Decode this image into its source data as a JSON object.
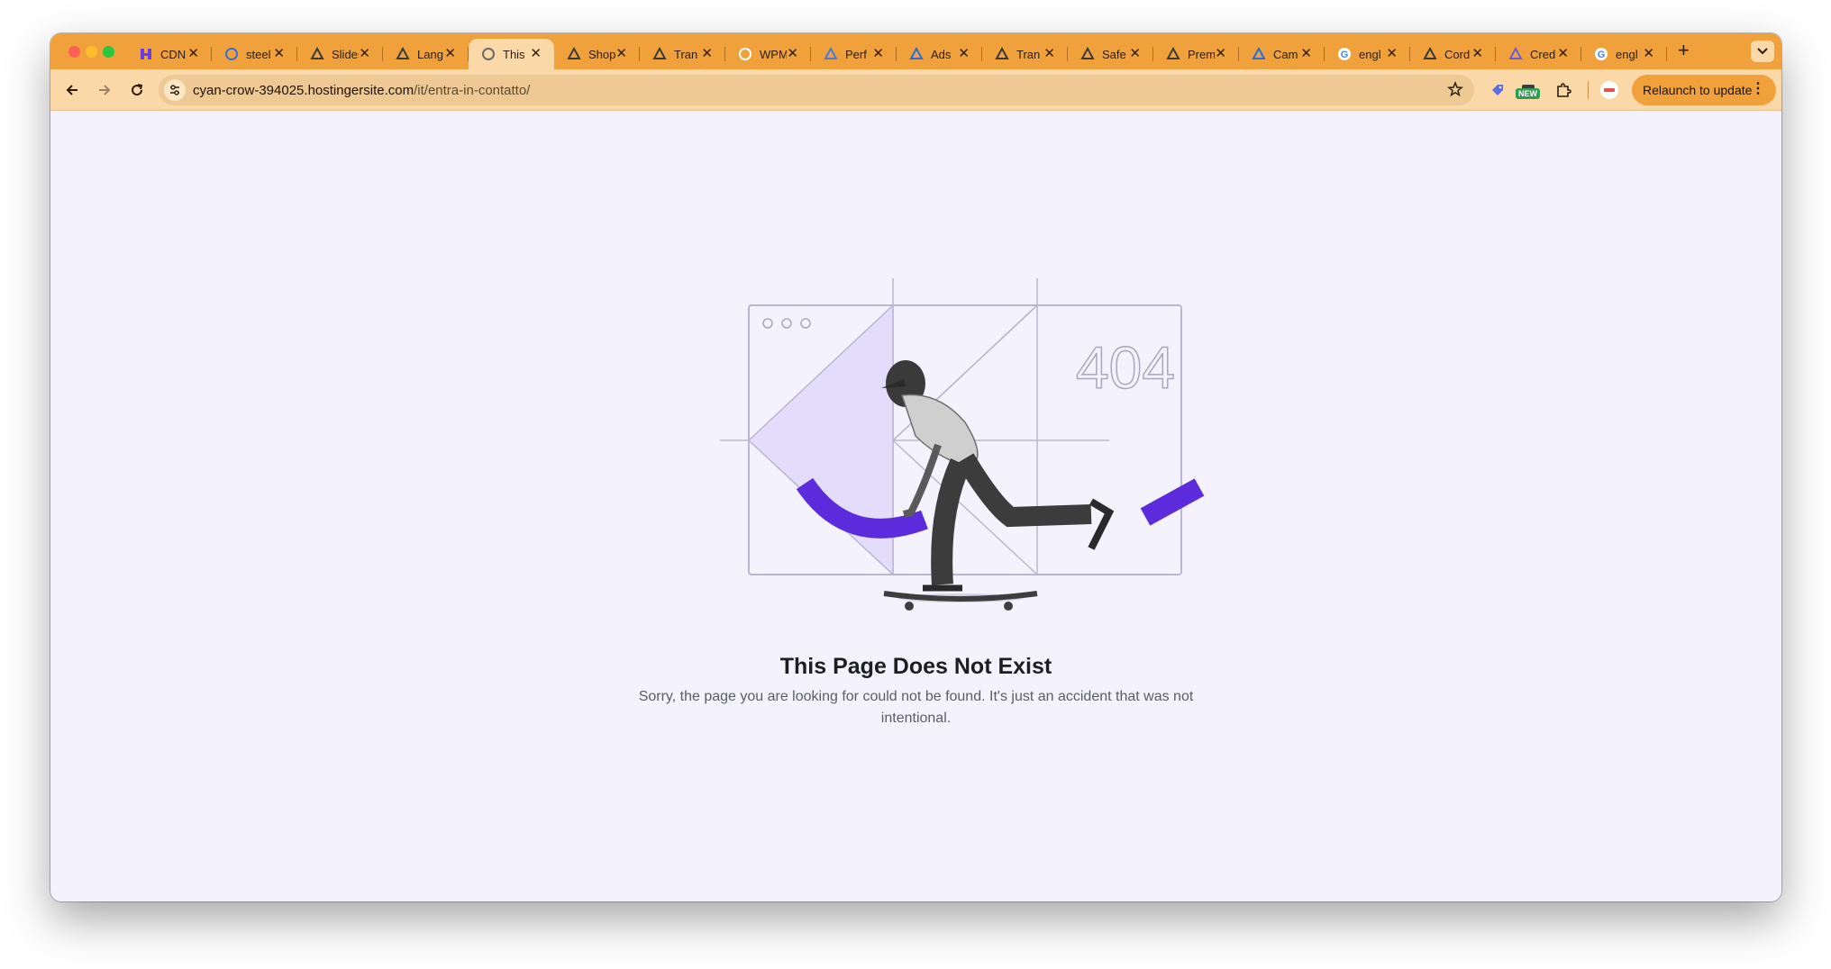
{
  "browser": {
    "tabs": [
      {
        "title": "CDN",
        "icon": "hostinger-icon",
        "color": "#673de6",
        "active": false
      },
      {
        "title": "steel",
        "icon": "circle-doc-icon",
        "color": "#3b6fd8",
        "active": false
      },
      {
        "title": "Slides",
        "icon": "triangle-logo-icon",
        "color": "#3b3b3b",
        "active": false
      },
      {
        "title": "Lang",
        "icon": "triangle-logo-icon",
        "color": "#3b3b3b",
        "active": false
      },
      {
        "title": "This",
        "icon": "globe-icon",
        "color": "#6b6b6b",
        "active": true
      },
      {
        "title": "Shop",
        "icon": "triangle-logo-icon",
        "color": "#3b3b3b",
        "active": false
      },
      {
        "title": "Tran",
        "icon": "headset-icon",
        "color": "#3b3b3b",
        "active": false
      },
      {
        "title": "WPM",
        "icon": "wordpress-icon",
        "color": "#ffffff",
        "active": false
      },
      {
        "title": "Perf",
        "icon": "analytics-icon",
        "color": "#4a7bd8",
        "active": false
      },
      {
        "title": "Ads",
        "icon": "meta-icon",
        "color": "#2d6ae0",
        "active": false
      },
      {
        "title": "Tran",
        "icon": "headset-icon",
        "color": "#3b3b3b",
        "active": false
      },
      {
        "title": "Safe",
        "icon": "triangle-logo-icon",
        "color": "#3b3b3b",
        "active": false
      },
      {
        "title": "Prem",
        "icon": "triangle-logo-icon",
        "color": "#3b3b3b",
        "active": false
      },
      {
        "title": "Cam",
        "icon": "google-ads-icon",
        "color": "#2d6ae0",
        "active": false
      },
      {
        "title": "engl",
        "icon": "google-icon",
        "color": "#4285f4",
        "active": false
      },
      {
        "title": "Cord",
        "icon": "triangle-logo-icon",
        "color": "#3b3b3b",
        "active": false
      },
      {
        "title": "Cred",
        "icon": "api-icon",
        "color": "#6b5bd8",
        "active": false
      },
      {
        "title": "engl",
        "icon": "google-icon",
        "color": "#4285f4",
        "active": false
      }
    ],
    "new_tab_symbol": "+",
    "address": {
      "domain": "cyan-crow-394025.hostingersite.com",
      "path": "/it/entra-in-contatto/"
    },
    "new_badge": "NEW",
    "relaunch_label": "Relaunch to update",
    "colors": {
      "tabstrip": "#f0a13c",
      "toolbar": "#fbd8a8",
      "page_bg": "#f3f2fd",
      "accent_purple": "#5b2bdc"
    }
  },
  "page": {
    "illustration_number": "404",
    "title": "This Page Does Not Exist",
    "description": "Sorry, the page you are looking for could not be found. It's just an accident that was not intentional."
  }
}
